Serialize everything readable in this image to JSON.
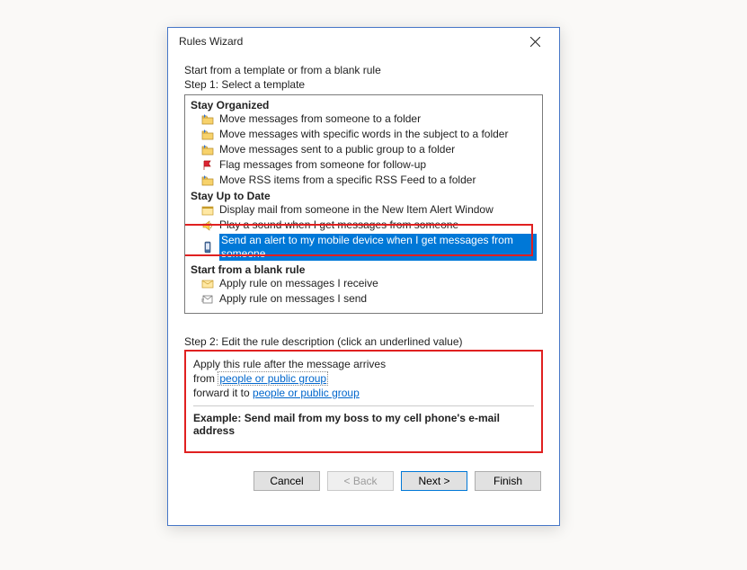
{
  "dialog": {
    "title": "Rules Wizard",
    "intro": "Start from a template or from a blank rule",
    "step1_label": "Step 1: Select a template",
    "step2_label": "Step 2: Edit the rule description (click an underlined value)"
  },
  "groups": {
    "g1": "Stay Organized",
    "g2": "Stay Up to Date",
    "g3": "Start from a blank rule"
  },
  "items": {
    "i1": "Move messages from someone to a folder",
    "i2": "Move messages with specific words in the subject to a folder",
    "i3": "Move messages sent to a public group to a folder",
    "i4": "Flag messages from someone for follow-up",
    "i5": "Move RSS items from a specific RSS Feed to a folder",
    "i6": "Display mail from someone in the New Item Alert Window",
    "i7": "Play a sound when I get messages from someone",
    "i8": "Send an alert to my mobile device when I get messages from someone",
    "i9": "Apply rule on messages I receive",
    "i10": "Apply rule on messages I send"
  },
  "desc": {
    "line1": "Apply this rule after the message arrives",
    "line2_prefix": "from ",
    "line2_link": "people or public group",
    "line3_prefix": "forward it to ",
    "line3_link": "people or public group",
    "example": "Example: Send mail from my boss to my cell phone's e-mail address"
  },
  "buttons": {
    "cancel": "Cancel",
    "back": "< Back",
    "next": "Next >",
    "finish": "Finish"
  }
}
